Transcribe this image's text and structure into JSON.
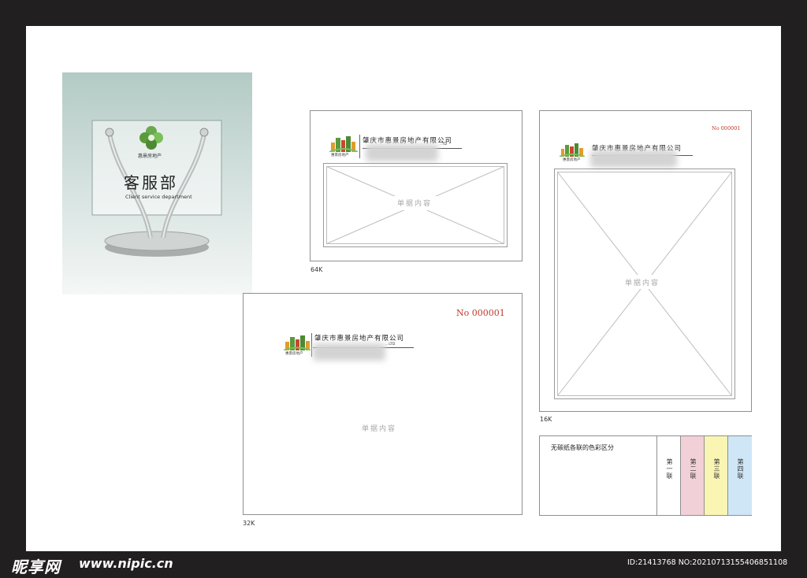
{
  "signage": {
    "company_name": "惠景房地产",
    "dept_title": "客服部",
    "dept_subtitle": "Client service department"
  },
  "sheets": {
    "s64k": {
      "size_label": "64K",
      "company": "肇庆市惠景房地产有限公司",
      "company_en_tail": "..TD",
      "logo_caption": "惠景房地产",
      "content_label": "单据内容"
    },
    "s32k": {
      "size_label": "32K",
      "number": "No 000001",
      "company": "肇庆市惠景房地产有限公司",
      "company_en_tail": "., LTD",
      "logo_caption": "惠景房地产",
      "content_label": "单据内容"
    },
    "s16k": {
      "size_label": "16K",
      "number": "No 000001",
      "company": "肇庆市惠景房地产有限公司",
      "logo_caption": "惠景房地产",
      "content_label": "单据内容"
    }
  },
  "legend": {
    "title": "无碳纸各联的色彩区分",
    "copies": [
      {
        "label": "第一联",
        "color": "#ffffff"
      },
      {
        "label": "第二联",
        "color": "#f2d0d8"
      },
      {
        "label": "第三联",
        "color": "#fbf5b4"
      },
      {
        "label": "第四联",
        "color": "#cfe6f7"
      }
    ]
  },
  "colors": {
    "accent_red": "#c0392b",
    "logo_green": "#5a9a3b",
    "logo_orange": "#e39b2d"
  },
  "footer": {
    "site_brand": "昵享网",
    "site_url": "www.nipic.cn",
    "image_id": "ID:21413768 NO:20210713155406851108"
  }
}
